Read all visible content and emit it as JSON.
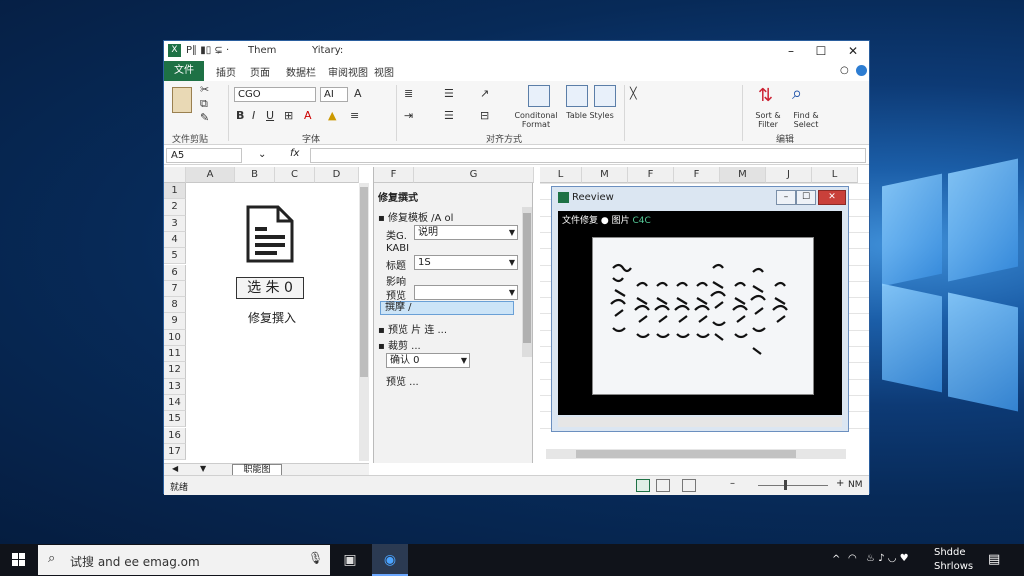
{
  "window": {
    "title_left": "P∥ ▮▯ ⊊ ·",
    "title_mid": "Them",
    "title_right": "Yitary:",
    "minimize": "–",
    "maximize": "☐",
    "close": "✕"
  },
  "tabs": [
    {
      "label": "文件"
    },
    {
      "label": "插页"
    },
    {
      "label": "页面"
    },
    {
      "label": "数据栏"
    },
    {
      "label": "审阅视图"
    },
    {
      "label": "视图"
    }
  ],
  "ribbon": {
    "font_name": "CGO",
    "font_size": "AI",
    "groups": [
      "文件剪贴",
      "字体",
      "对齐方式",
      "编辑"
    ],
    "buttons": {
      "bold": "B",
      "italic": "I",
      "underline": "U",
      "gallery_a": "Conditonal Format",
      "gallery_b": "Table Styles",
      "sort": "Sort & Filter",
      "find": "Find & Select"
    }
  },
  "formula_bar": {
    "name_box": "A5",
    "fx": "fx"
  },
  "sheet_left": {
    "columns": [
      "A",
      "B",
      "C",
      "D"
    ],
    "rows": [
      "1",
      "2",
      "3",
      "4",
      "5",
      "6",
      "7",
      "8",
      "9",
      "10",
      "11",
      "12",
      "13",
      "14",
      "15",
      "16",
      "17"
    ],
    "button_label": "选 朱 0",
    "caption": "修复撰入",
    "sheet_tab": "职能图"
  },
  "mid_pane": {
    "col_f": "F",
    "col_g": "G",
    "title": "修复撰式",
    "section1": "▪ 修复模板 /A ol",
    "field1_label": "类G.",
    "field1_value": "说明",
    "field2_label": "KABI",
    "field3_label": "标题",
    "field3_value": "1S",
    "field4_label": "影响",
    "field5_label": "预览",
    "highlight": "撰摩 /",
    "section2": "▪ 预览 片 连 ...",
    "section3": "▪ 裁剪 ...",
    "combo_label": "确认 0",
    "footer": "预览 ..."
  },
  "sheet_right": {
    "columns": [
      "L",
      "M",
      "F",
      "F",
      "M",
      "J",
      "L"
    ]
  },
  "preview": {
    "title": "Reeview",
    "toolbar_a": "文件修复",
    "toolbar_b": "图片",
    "toolbar_c": "C4C"
  },
  "status": {
    "left": "就绪",
    "zoom": "NM"
  },
  "taskbar": {
    "search_text": "试搜 and ee emag.om",
    "tray_time": "Shdde",
    "tray_date": "Shrlows"
  }
}
